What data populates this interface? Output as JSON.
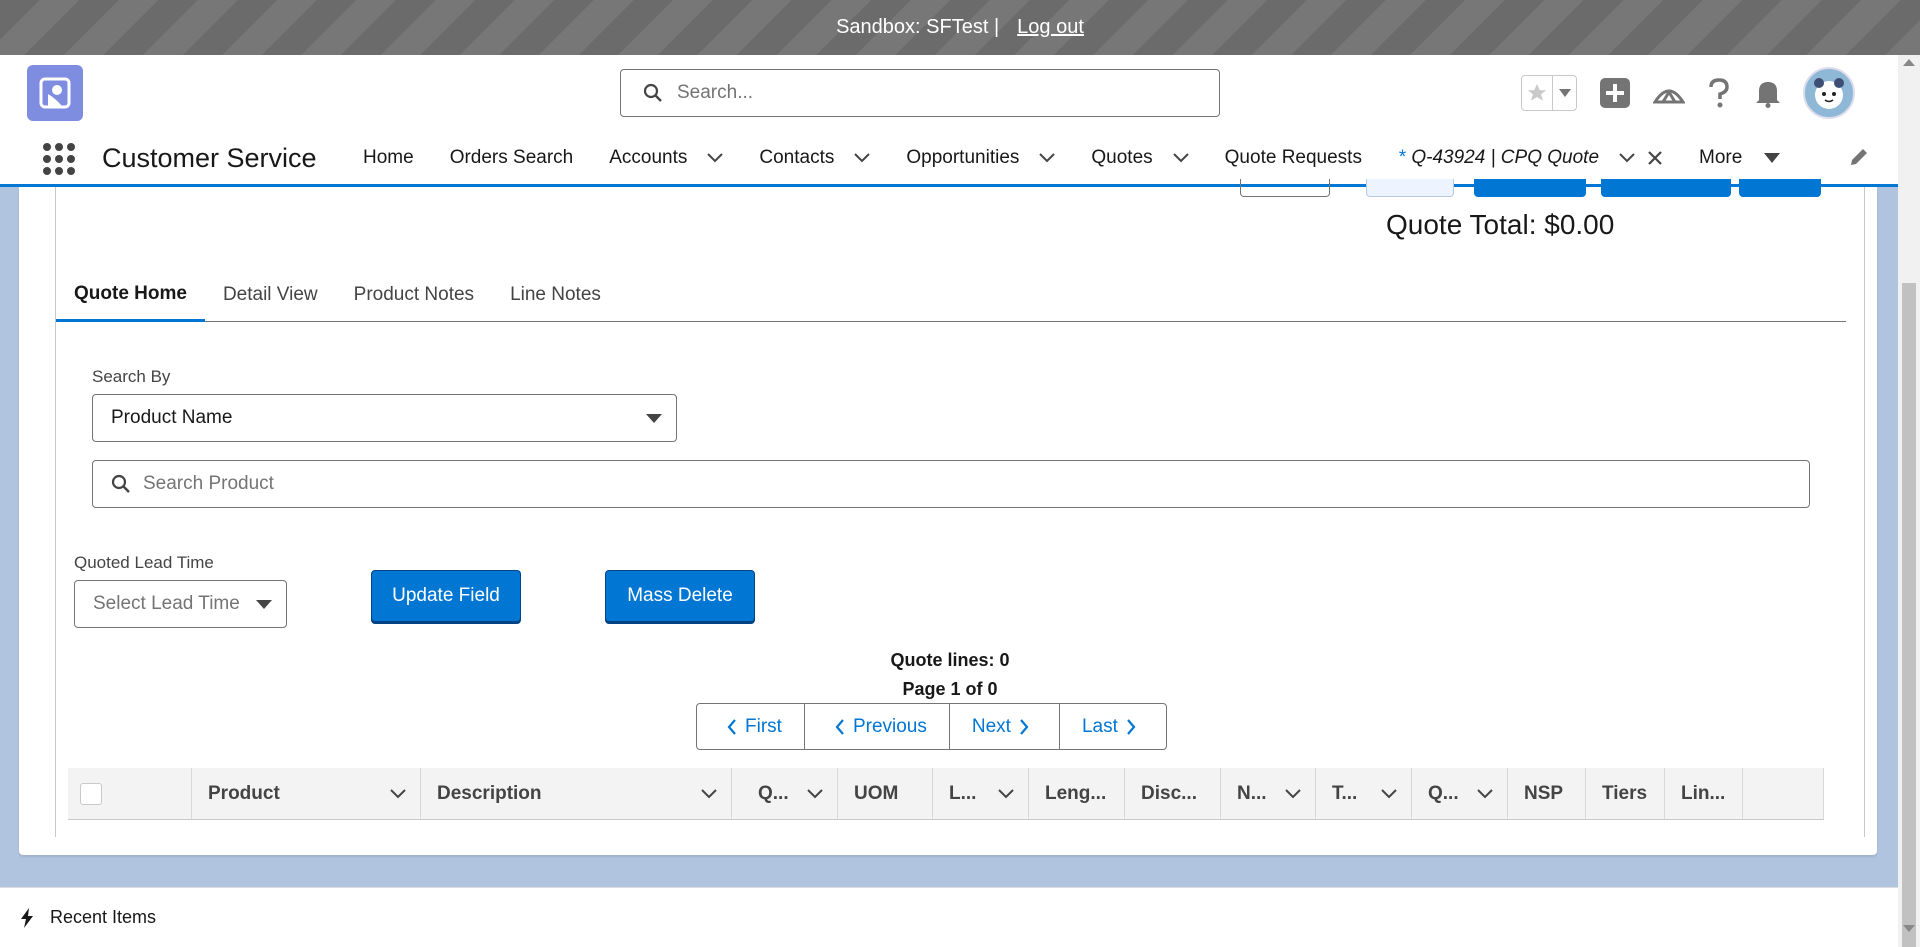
{
  "sandbox": {
    "text": "Sandbox: SFTest |",
    "logout": "Log out"
  },
  "header": {
    "search_placeholder": "Search..."
  },
  "nav": {
    "app_name": "Customer Service",
    "items": [
      {
        "label": "Home"
      },
      {
        "label": "Orders Search"
      },
      {
        "label": "Accounts"
      },
      {
        "label": "Contacts"
      },
      {
        "label": "Opportunities"
      },
      {
        "label": "Quotes"
      },
      {
        "label": "Quote Requests"
      }
    ],
    "active_tab": {
      "prefix": "*",
      "label": "Q-43924 | CPQ Quote"
    },
    "more": "More"
  },
  "quote": {
    "total": "Quote Total: $0.00"
  },
  "tabs": [
    "Quote Home",
    "Detail View",
    "Product Notes",
    "Line Notes"
  ],
  "search_by": {
    "label": "Search By",
    "value": "Product Name"
  },
  "search_product": {
    "placeholder": "Search Product"
  },
  "lead_time": {
    "label": "Quoted Lead Time",
    "placeholder": "Select Lead Time"
  },
  "buttons": {
    "update_field": "Update Field",
    "mass_delete": "Mass Delete"
  },
  "summary": {
    "quote_lines": "Quote lines: 0",
    "page": "Page 1 of 0"
  },
  "pager": {
    "first": "First",
    "previous": "Previous",
    "next": "Next",
    "last": "Last"
  },
  "table": {
    "columns": [
      "Product",
      "Description",
      "Q...",
      "UOM",
      "L...",
      "Leng...",
      "Disc...",
      "N...",
      "T...",
      "Q...",
      "NSP",
      "Tiers",
      "Lin..."
    ]
  },
  "footer": {
    "recent_items": "Recent Items"
  },
  "colors": {
    "brand": "#0176d3",
    "banner": "#6b6b6b",
    "background": "#b0c4df"
  }
}
